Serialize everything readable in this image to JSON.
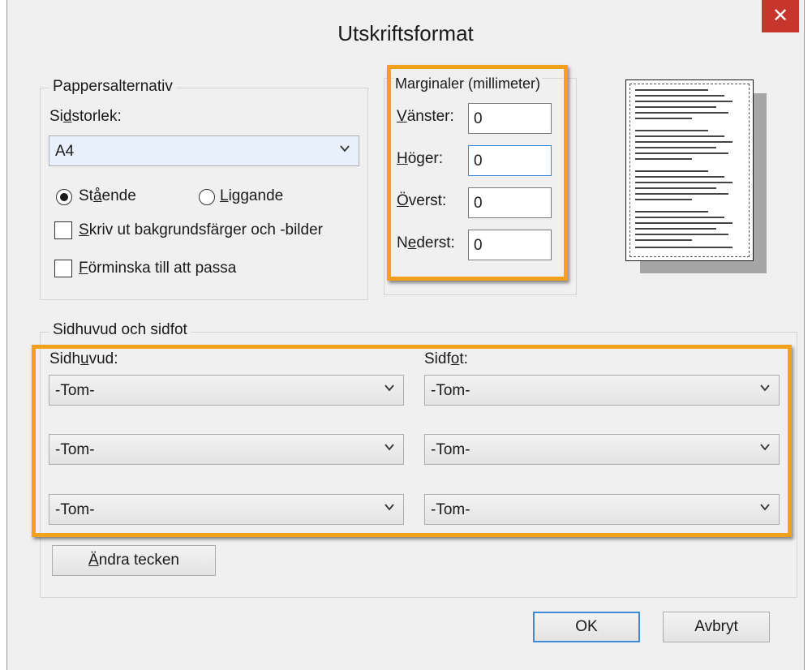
{
  "window": {
    "title": "Utskriftsformat",
    "close_glyph": "✕"
  },
  "paper": {
    "legend": "Pappersalternativ",
    "size_label_pre": "Si",
    "size_label_u": "d",
    "size_label_post": "storlek:",
    "size_value": "A4",
    "portrait_pre": "St",
    "portrait_u": "å",
    "portrait_post": "ende",
    "portrait_selected": true,
    "landscape_u": "L",
    "landscape_post": "iggande",
    "print_bg_u": "S",
    "print_bg_post": "kriv ut bakgrundsfärger och -bilder",
    "shrink_u": "F",
    "shrink_post": "örminska till att passa"
  },
  "margins": {
    "legend": "Marginaler (millimeter)",
    "left_u": "V",
    "left_post": "änster:",
    "left_value": "0",
    "right_u": "H",
    "right_post": "öger:",
    "right_value": "0",
    "top_u": "Ö",
    "top_post": "verst:",
    "top_value": "0",
    "bottom_pre": "N",
    "bottom_u": "e",
    "bottom_post": "derst:",
    "bottom_value": "0"
  },
  "headerfooter": {
    "legend": "Sidhuvud och sidfot",
    "header_pre": "Sidh",
    "header_u": "u",
    "header_post": "vud:",
    "footer_pre": "Sidf",
    "footer_u": "o",
    "footer_post": "t:",
    "header_values": [
      "-Tom-",
      "-Tom-",
      "-Tom-"
    ],
    "footer_values": [
      "-Tom-",
      "-Tom-",
      "-Tom-"
    ],
    "change_font_u": "Ä",
    "change_font_post": "ndra tecken"
  },
  "buttons": {
    "ok": "OK",
    "cancel": "Avbryt"
  },
  "colors": {
    "highlight": "#f2a11c",
    "close_bg": "#c7362d",
    "focus": "#3c8ad8"
  }
}
